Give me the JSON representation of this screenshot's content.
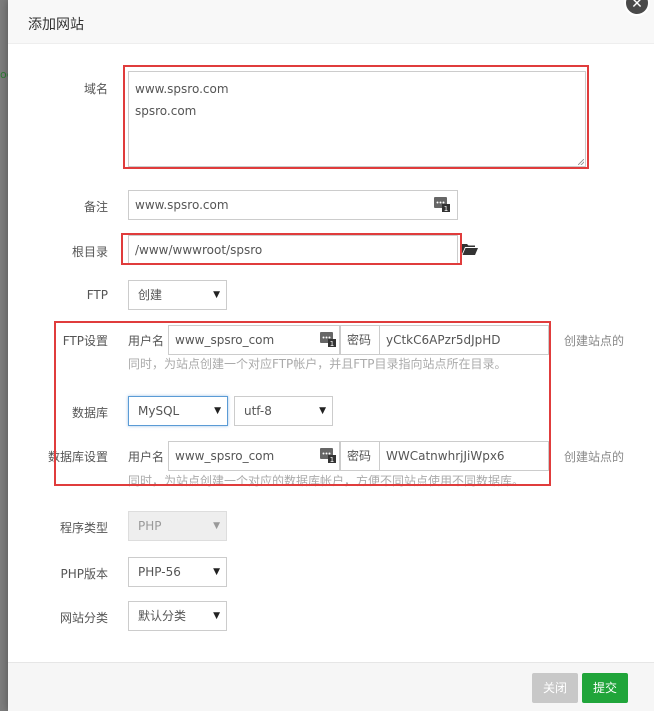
{
  "dialog": {
    "title": "添加网站",
    "close_glyph": "✕"
  },
  "form": {
    "domain": {
      "label": "域名",
      "lines": [
        "www.spsro.com",
        "spsro.com"
      ]
    },
    "remark": {
      "label": "备注",
      "value": "www.spsro.com"
    },
    "root": {
      "label": "根目录",
      "value": "/www/wwwroot/spsro"
    },
    "ftp": {
      "label": "FTP",
      "selected": "创建"
    },
    "ftp_settings": {
      "label": "FTP设置",
      "username_label": "用户名",
      "username": "www_spsro_com",
      "password_label": "密码",
      "password": "yCtkC6APzr5dJpHD",
      "side_note": "创建站点的",
      "hint": "同时，为站点创建一个对应FTP帐户，并且FTP目录指向站点所在目录。"
    },
    "database": {
      "label": "数据库",
      "type": "MySQL",
      "charset": "utf-8"
    },
    "db_settings": {
      "label": "数据库设置",
      "username_label": "用户名",
      "username": "www_spsro_com",
      "password_label": "密码",
      "password": "WWCatnwhrjJiWpx6",
      "side_note": "创建站点的",
      "hint": "同时，为站点创建一个对应的数据库帐户，方便不同站点使用不同数据库。"
    },
    "program_type": {
      "label": "程序类型",
      "selected": "PHP"
    },
    "php_version": {
      "label": "PHP版本",
      "selected": "PHP-56"
    },
    "site_category": {
      "label": "网站分类",
      "selected": "默认分类"
    }
  },
  "footer": {
    "close_label": "关闭",
    "submit_label": "提交"
  },
  "icons": {
    "dropdown": "▼",
    "folder": "folder-open-icon",
    "password_generator": "password-generator-icon"
  },
  "colors": {
    "highlight_border": "#e03c3c",
    "submit": "#20a53a",
    "close_disabled": "#c8c8c8",
    "focus": "#5b9bd5"
  }
}
